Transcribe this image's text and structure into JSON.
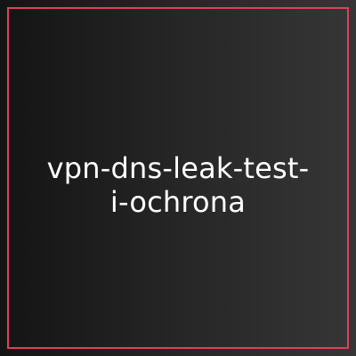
{
  "card": {
    "title_lines": [
      "vpn-dns-leak-test-",
      "i-ochrona"
    ]
  },
  "colors": {
    "frame": "#e0405a",
    "text": "#ffffff",
    "gradient_start": "#141414",
    "gradient_end": "#363636"
  }
}
